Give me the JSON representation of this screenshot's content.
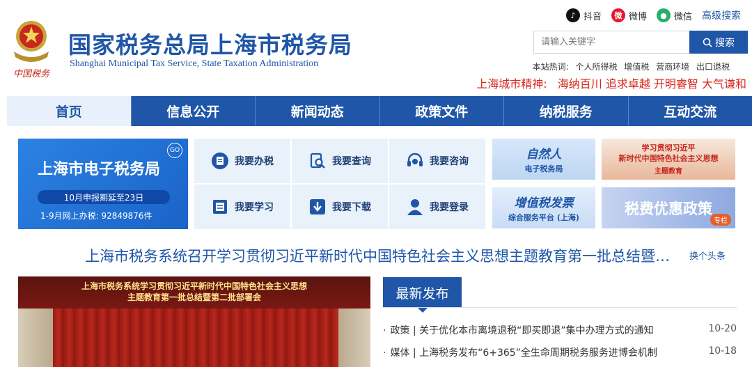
{
  "header": {
    "title_cn": "国家税务总局上海市税务局",
    "title_en": "Shanghai Municipal Tax Service, State Taxation Administration",
    "emblem_text": "中国税务",
    "social": [
      {
        "label": "抖音",
        "icon": "tiktok-icon",
        "color": "#111111"
      },
      {
        "label": "微博",
        "icon": "weibo-icon",
        "color": "#e6162d"
      },
      {
        "label": "微信",
        "icon": "wechat-icon",
        "color": "#2aae67"
      }
    ],
    "advanced_search": "高级搜索",
    "search_placeholder": "请输入关键字",
    "search_button": "搜索",
    "hot_label": "本站热词:",
    "hot_words": [
      "个人所得税",
      "增值税",
      "营商环境",
      "出口退税"
    ],
    "spirit_label": "上海城市精神:",
    "spirit_text": "海纳百川 追求卓越 开明睿智 大气谦和"
  },
  "nav": [
    "首页",
    "信息公开",
    "新闻动态",
    "政策文件",
    "纳税服务",
    "互动交流"
  ],
  "portal": {
    "title": "上海市电子税务局",
    "badge": "GO",
    "notice": "10月申报期延至23日",
    "count": "1-9月网上办税: 92849876件"
  },
  "quick_links": [
    {
      "label": "我要办税",
      "icon": "tax-handling-icon"
    },
    {
      "label": "我要查询",
      "icon": "query-icon"
    },
    {
      "label": "我要咨询",
      "icon": "consult-headset-icon"
    },
    {
      "label": "我要学习",
      "icon": "study-book-icon"
    },
    {
      "label": "我要下载",
      "icon": "download-icon"
    },
    {
      "label": "我要登录",
      "icon": "login-user-icon"
    }
  ],
  "ads": {
    "ad1_big": "自然人",
    "ad1_small": "电子税务局",
    "ad2_big": "学习贯彻习近平\n新时代中国特色社会主义思想",
    "ad2_small": "主题教育",
    "ad3_big": "增值税发票",
    "ad3_small": "综合服务平台 (上海)",
    "ad4_big": "税费优惠政策",
    "ad4_tag": "专栏"
  },
  "headline": {
    "text": "上海市税务系统召开学习贯彻习近平新时代中国特色社会主义思想主题教育第一批总结暨第二批部署会",
    "swap": "换个头条"
  },
  "photo": {
    "banner_line1": "上海市税务系统学习贯彻习近平新时代中国特色社会主义思想",
    "banner_line2": "主题教育第一批总结暨第二批部署会"
  },
  "latest": {
    "title": "最新发布",
    "items": [
      {
        "text": "政策 | 关于优化本市离境退税“即买即退”集中办理方式的通知",
        "date": "10-20"
      },
      {
        "text": "媒体 | 上海税务发布“6+365”全生命周期税务服务进博会机制",
        "date": "10-18"
      }
    ]
  }
}
